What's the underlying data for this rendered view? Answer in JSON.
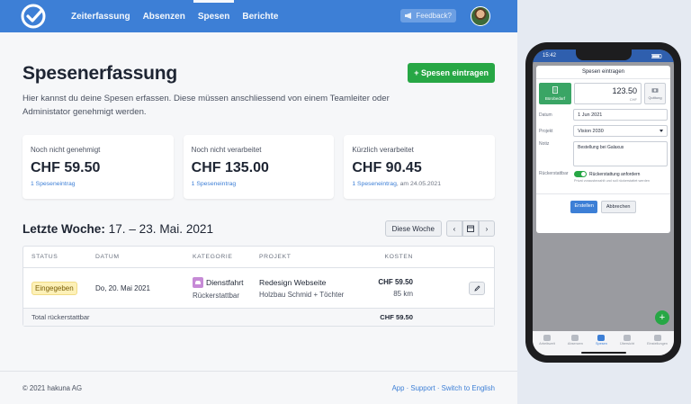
{
  "nav": {
    "items": [
      {
        "label": "Zeiterfassung",
        "active": false
      },
      {
        "label": "Absenzen",
        "active": false
      },
      {
        "label": "Spesen",
        "active": true
      },
      {
        "label": "Berichte",
        "active": false
      }
    ],
    "feedback_label": "Feedback?"
  },
  "page": {
    "title": "Spesenerfassung",
    "intro": "Hier kannst du deine Spesen erfassen. Diese müssen anschliessend von einem Teamleiter oder Administator genehmigt werden.",
    "add_button": "+ Spesen eintragen"
  },
  "cards": [
    {
      "label": "Noch nicht genehmigt",
      "value": "CHF 59.50",
      "link": "1 Speseneintrag",
      "suffix": ""
    },
    {
      "label": "Noch nicht verarbeitet",
      "value": "CHF 135.00",
      "link": "1 Speseneintrag",
      "suffix": ""
    },
    {
      "label": "Kürzlich verarbeitet",
      "value": "CHF 90.45",
      "link": "1 Speseneintrag",
      "suffix": ", am 24.05.2021"
    }
  ],
  "week": {
    "prefix": "Letzte Woche:",
    "range": "17. – 23. Mai. 2021",
    "this_week_button": "Diese Woche",
    "prev_glyph": "‹",
    "next_glyph": "›"
  },
  "table": {
    "headers": [
      "STATUS",
      "DATUM",
      "KATEGORIE",
      "PROJEKT",
      "KOSTEN"
    ],
    "rows": [
      {
        "status": "Eingegeben",
        "date": "Do, 20. Mai 2021",
        "category": "Dienstfahrt",
        "category_sub": "Rückerstattbar",
        "project": "Redesign Webseite",
        "project_sub": "Holzbau Schmid + Töchter",
        "cost": "CHF 59.50",
        "cost_sub": "85 km"
      }
    ],
    "footer_label": "Total rückerstattbar",
    "footer_value": "CHF 59.50"
  },
  "footer": {
    "copyright": "© 2021 hakuna AG",
    "links": "App · Support · Switch to English"
  },
  "phone": {
    "time": "15:42",
    "modal_title": "Spesen eintragen",
    "type_label": "Bürobedarf",
    "amount": "123.50",
    "currency": "CHF",
    "receipt_label": "Quittung",
    "date_label": "Datum",
    "date_value": "1 Jun 2021",
    "project_label": "Projekt",
    "project_value": "Vision 2030",
    "note_label": "Notiz",
    "note_value": "Bestellung bei Galaxus",
    "refund_label": "Rückerstattbar",
    "refund_toggle_label": "Rückerstattung anfordern",
    "refund_help": "Privat vorausbezahlt und soll rückerstattet werden",
    "create_button": "Erstellen",
    "cancel_button": "Abbrechen",
    "tabs": [
      "Arbeitszeit",
      "Absenzen",
      "Spesen",
      "Übersicht",
      "Einstellungen"
    ]
  },
  "colors": {
    "brand": "#3d7fd6",
    "success": "#27a745",
    "badge_bg": "#fdf1b8"
  }
}
